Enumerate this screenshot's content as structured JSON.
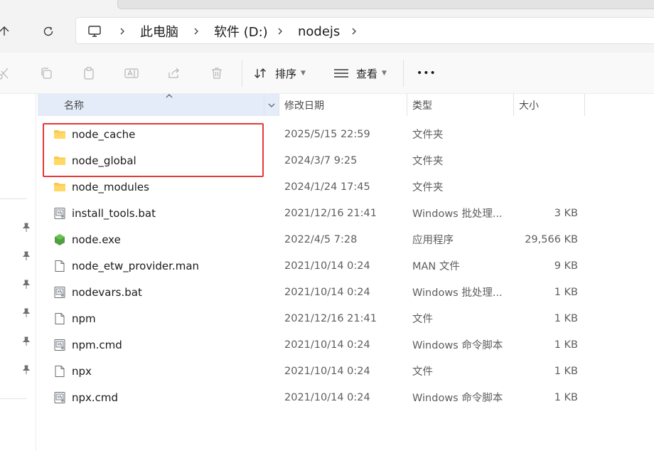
{
  "address": {
    "crumbs": [
      "此电脑",
      "软件 (D:)",
      "nodejs"
    ]
  },
  "toolbar": {
    "sort_label": "排序",
    "view_label": "查看",
    "more_label": "•••"
  },
  "columns": {
    "name": "名称",
    "modified": "修改日期",
    "type": "类型",
    "size": "大小"
  },
  "files": [
    {
      "name": "node_cache",
      "modified": "2025/5/15 22:59",
      "type": "文件夹",
      "size": "",
      "icon": "folder-icon"
    },
    {
      "name": "node_global",
      "modified": "2024/3/7 9:25",
      "type": "文件夹",
      "size": "",
      "icon": "folder-icon"
    },
    {
      "name": "node_modules",
      "modified": "2024/1/24 17:45",
      "type": "文件夹",
      "size": "",
      "icon": "folder-icon"
    },
    {
      "name": "install_tools.bat",
      "modified": "2021/12/16 21:41",
      "type": "Windows 批处理...",
      "size": "3 KB",
      "icon": "batch-file-icon"
    },
    {
      "name": "node.exe",
      "modified": "2022/4/5 7:28",
      "type": "应用程序",
      "size": "29,566 KB",
      "icon": "nodejs-icon"
    },
    {
      "name": "node_etw_provider.man",
      "modified": "2021/10/14 0:24",
      "type": "MAN 文件",
      "size": "9 KB",
      "icon": "file-icon"
    },
    {
      "name": "nodevars.bat",
      "modified": "2021/10/14 0:24",
      "type": "Windows 批处理...",
      "size": "1 KB",
      "icon": "batch-file-icon"
    },
    {
      "name": "npm",
      "modified": "2021/12/16 21:41",
      "type": "文件",
      "size": "1 KB",
      "icon": "file-icon"
    },
    {
      "name": "npm.cmd",
      "modified": "2021/10/14 0:24",
      "type": "Windows 命令脚本",
      "size": "1 KB",
      "icon": "batch-file-icon"
    },
    {
      "name": "npx",
      "modified": "2021/10/14 0:24",
      "type": "文件",
      "size": "1 KB",
      "icon": "file-icon"
    },
    {
      "name": "npx.cmd",
      "modified": "2021/10/14 0:24",
      "type": "Windows 命令脚本",
      "size": "1 KB",
      "icon": "batch-file-icon"
    }
  ],
  "colors": {
    "highlight": "#e53935",
    "header_selected": "#e3ecf8",
    "folder": "#f8c94b"
  }
}
